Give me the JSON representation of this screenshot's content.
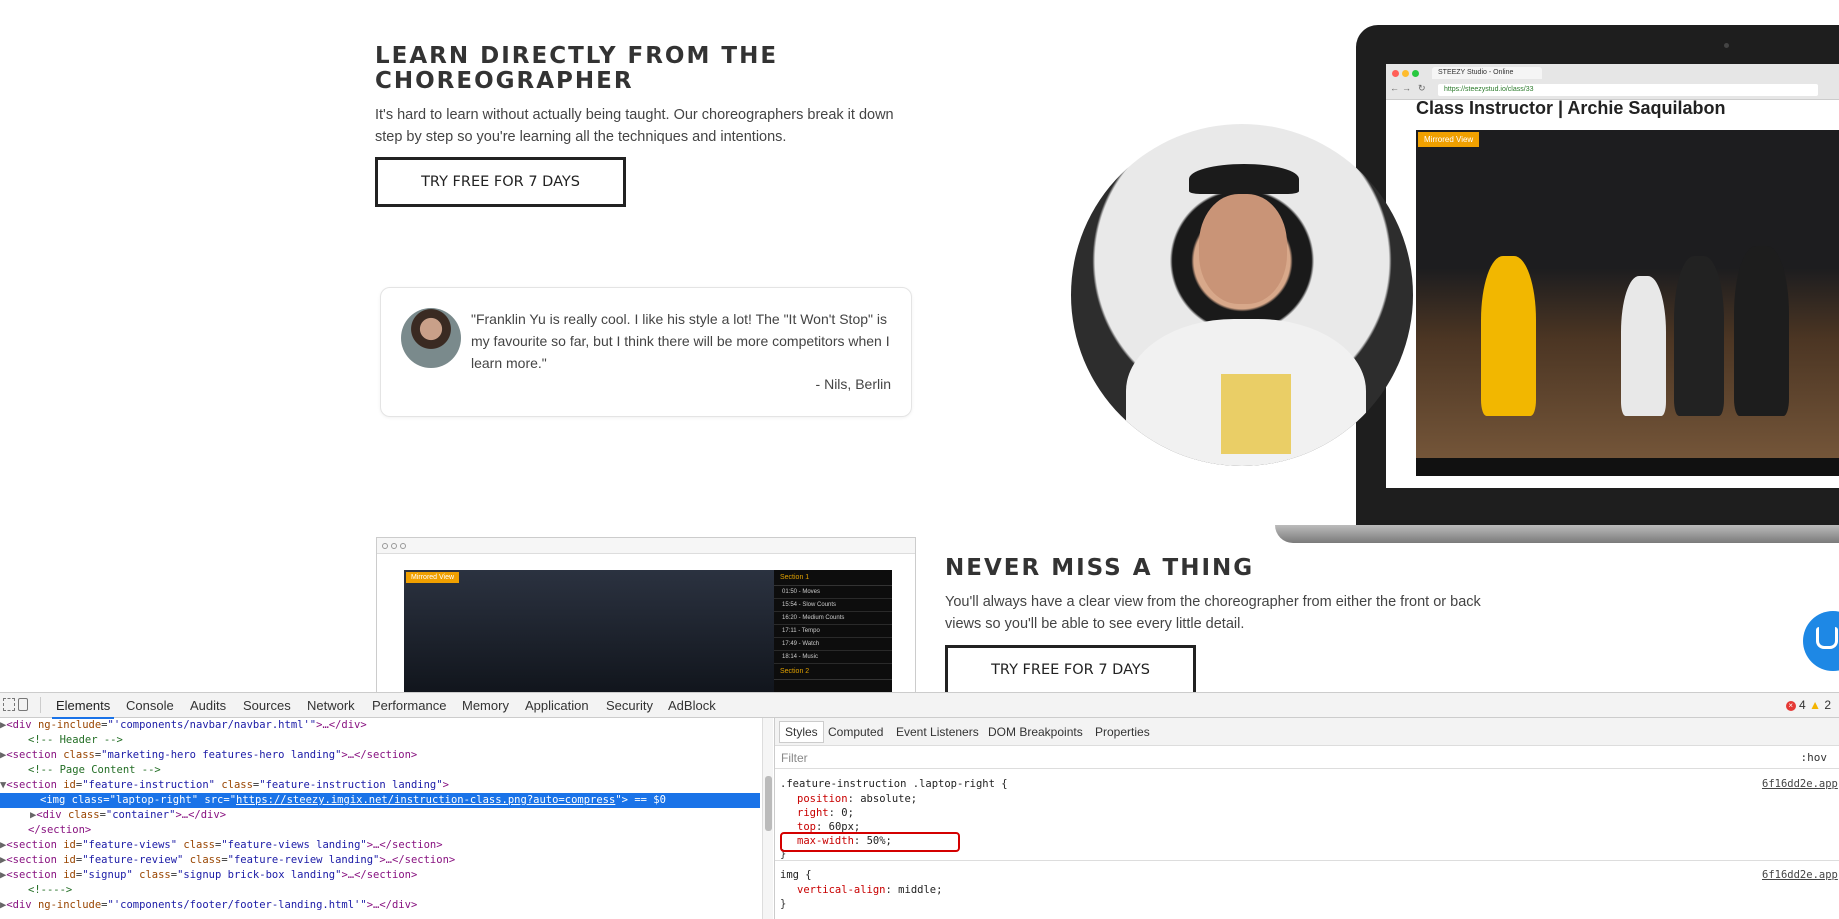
{
  "hero": {
    "title": "LEARN DIRECTLY FROM THE CHOREOGRAPHER",
    "description": "It's hard to learn without actually being taught. Our choreographers break it down step by step so you're learning all the techniques and intentions.",
    "cta": "TRY FREE FOR 7 DAYS"
  },
  "testimonial": {
    "quote": "\"Franklin Yu is really cool. I like his style a lot! The \"It Won't Stop\" is my favourite so far, but I think there will be more competitors when I learn more.\"",
    "author": "- Nils, Berlin"
  },
  "laptop": {
    "tab_title": "STEEZY Studio - Online",
    "url": "https://steezystud.io/class/33",
    "class_title": "Class Instructor | Archie Saquilabon",
    "mirrored_label": "Mirrored View"
  },
  "feature_views": {
    "title": "NEVER MISS A THING",
    "description": "You'll always have a clear view from the choreographer from either the front or back views so you'll be able to see every little detail.",
    "cta": "TRY FREE FOR 7 DAYS",
    "mini_badge": "Mirrored View",
    "sections": [
      {
        "header": "Section 1"
      },
      {
        "item": "01:50 - Moves"
      },
      {
        "item": "15:54 - Slow Counts"
      },
      {
        "item": "16:20 - Medium Counts"
      },
      {
        "item": "17:11 - Tempo"
      },
      {
        "item": "17:49 - Watch"
      },
      {
        "item": "18:14 - Music"
      },
      {
        "header": "Section 2"
      }
    ]
  },
  "devtools": {
    "tabs": [
      "Elements",
      "Console",
      "Audits",
      "Sources",
      "Network",
      "Performance",
      "Memory",
      "Application",
      "Security",
      "AdBlock"
    ],
    "active_tab": "Elements",
    "error_count": "4",
    "warning_count": "2",
    "styles_tabs": [
      "Styles",
      "Computed",
      "Event Listeners",
      "DOM Breakpoints",
      "Properties"
    ],
    "filter_placeholder": "Filter",
    "hov": ":hov",
    "dom": {
      "l1_a": "div",
      "l1_attr": "ng-include",
      "l1_val": "\"'components/navbar/navbar.html'\"",
      "l1_end": ">…</div>",
      "l2": "<!-- Header -->",
      "l3_attr": "class",
      "l3_val": "\"marketing-hero features-hero landing\"",
      "l4": "<!-- Page Content -->",
      "l5_id": "\"feature-instruction\"",
      "l5_class": "\"feature-instruction landing\"",
      "l6_class": "\"laptop-right\"",
      "l6_src": "https://steezy.imgix.net/instruction-class.png?auto=compress",
      "l6_eq": "== $0",
      "l7_class": "\"container\"",
      "l9_id": "\"feature-views\"",
      "l9_class": "\"feature-views landing\"",
      "l10_id": "\"feature-review\"",
      "l10_class": "\"feature-review landing\"",
      "l11_id": "\"signup\"",
      "l11_class": "\"signup brick-box landing\"",
      "l12": "<!---->",
      "l13_val": "\"'components/footer/footer-landing.html'\""
    },
    "rules": {
      "r1_selector": ".feature-instruction .laptop-right {",
      "r1_src": "6f16dd2e.app",
      "r1_decls": [
        {
          "p": "position",
          "v": "absolute;"
        },
        {
          "p": "right",
          "v": "0;"
        },
        {
          "p": "top",
          "v": "60px;"
        },
        {
          "p": "max-width",
          "v": "50%;"
        }
      ],
      "r2_selector": "img {",
      "r2_src": "6f16dd2e.app",
      "r2_decls": [
        {
          "p": "vertical-align",
          "v": "middle;"
        }
      ]
    }
  }
}
